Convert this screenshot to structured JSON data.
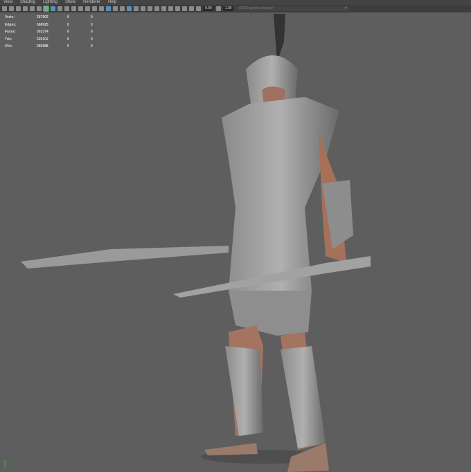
{
  "menu": [
    "View",
    "Shading",
    "Lighting",
    "Show",
    "Renderer",
    "Help"
  ],
  "toolbar": {
    "exposure": "0.00",
    "gamma": "1.00",
    "color_space": "sRGB gamma (legacy)"
  },
  "stats": [
    {
      "label": "Verts:",
      "value": "267902",
      "sel": "0",
      "comp": "0"
    },
    {
      "label": "Edges:",
      "value": "568925",
      "sel": "0",
      "comp": "0"
    },
    {
      "label": "Faces:",
      "value": "301374",
      "sel": "0",
      "comp": "0"
    },
    {
      "label": "Tris:",
      "value": "529102",
      "sel": "0",
      "comp": "0"
    },
    {
      "label": "UVs:",
      "value": "285988",
      "sel": "0",
      "comp": "0"
    }
  ]
}
